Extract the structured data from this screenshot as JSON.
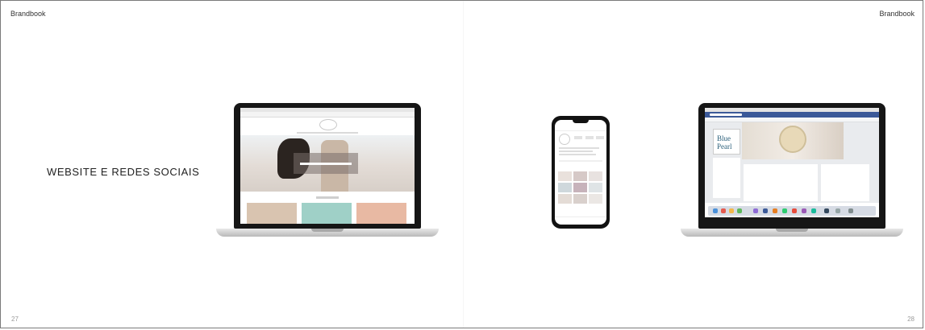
{
  "header": {
    "left_title": "Brandbook",
    "right_title": "Brandbook"
  },
  "section_title": "WEBSITE E REDES SOCIAIS",
  "pages": {
    "left_number": "27",
    "right_number": "28"
  },
  "mockups": {
    "laptop_website": {
      "icon": "laptop-website-mockup"
    },
    "phone_instagram": {
      "icon": "phone-instagram-mockup"
    },
    "laptop_facebook": {
      "icon": "laptop-facebook-mockup",
      "profile_logo_text": "Blue Pearl"
    }
  },
  "colors": {
    "facebook_blue": "#3b5998",
    "text": "#222222",
    "border": "#7a7a7a"
  }
}
